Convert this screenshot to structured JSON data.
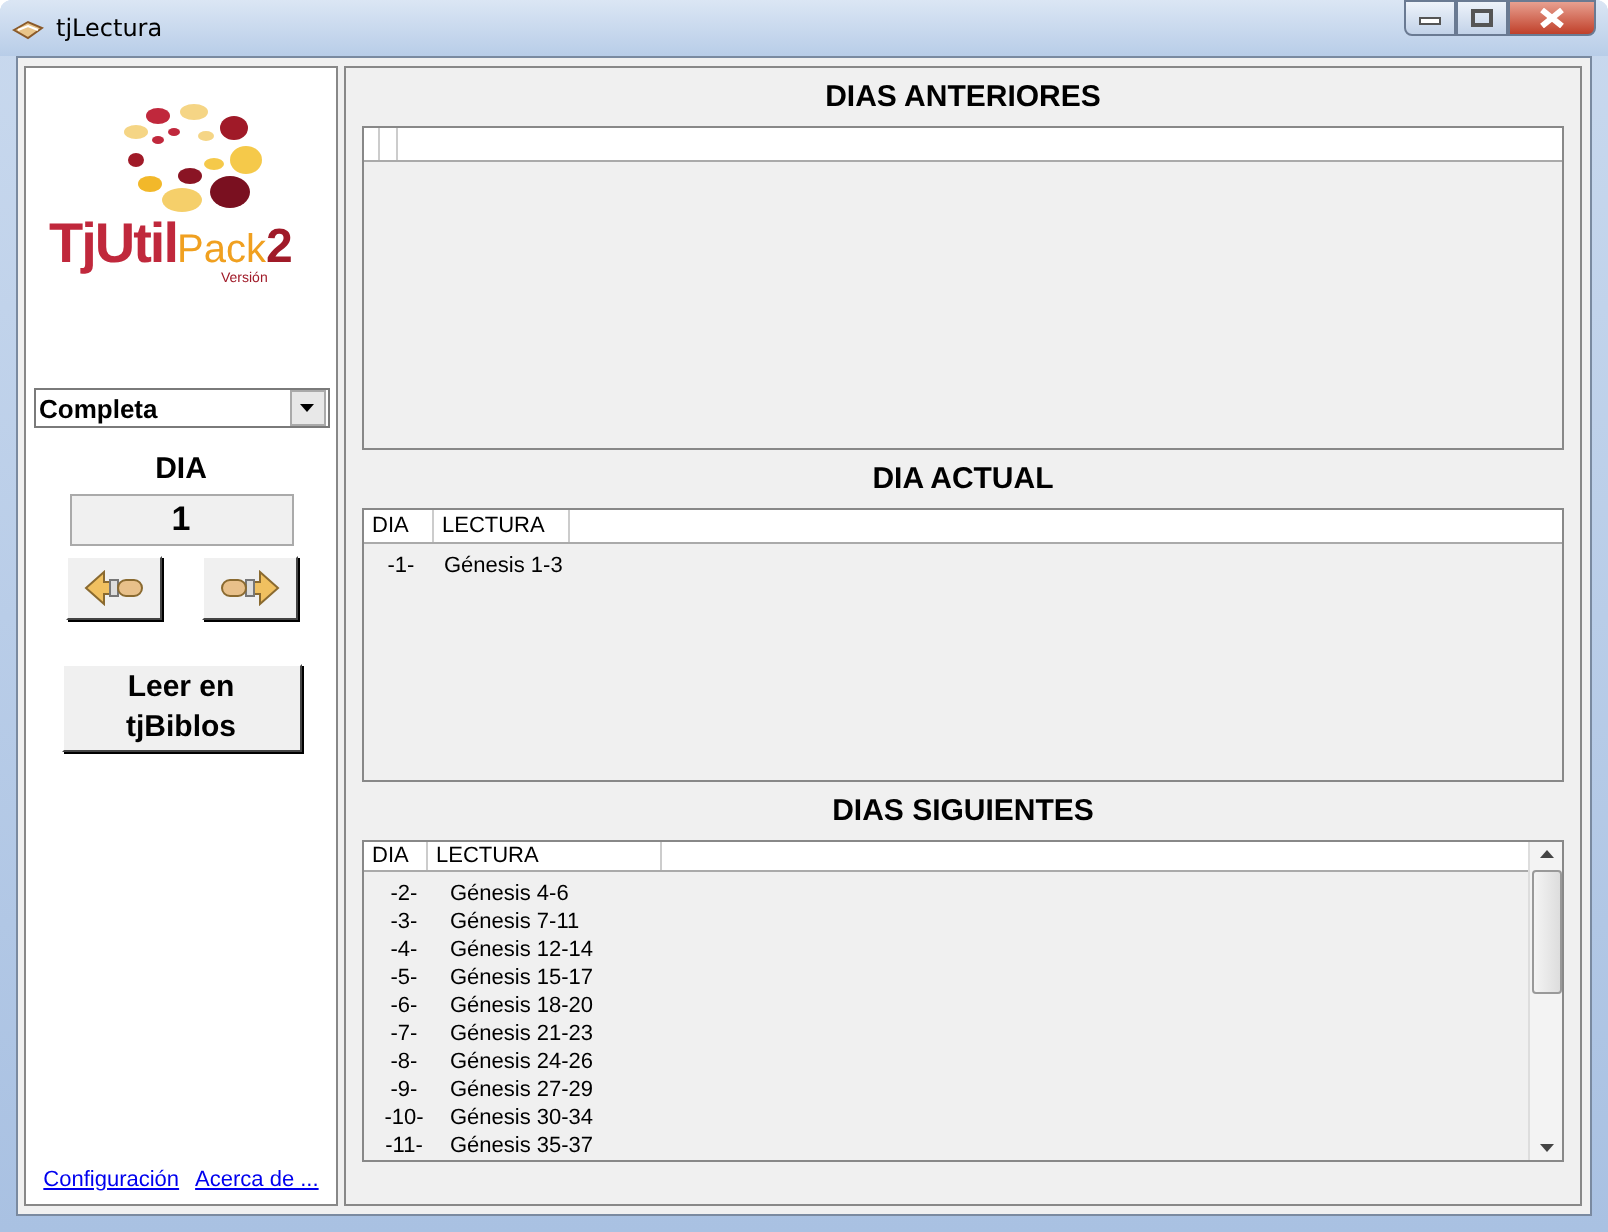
{
  "window": {
    "title": "tjLectura"
  },
  "logo": {
    "name": "TjUtil",
    "suffix": "Pack",
    "version_number": "2",
    "version_label": "Versión"
  },
  "plan_dropdown": {
    "value": "Completa"
  },
  "day": {
    "label": "DIA",
    "value": "1"
  },
  "read_button": {
    "label": "Leer en tjBiblos"
  },
  "links": [
    "Configuración",
    "Acerca de ..."
  ],
  "sections": [
    {
      "title": "DIAS ANTERIORES",
      "scrollbar": false
    },
    {
      "title": "DIA ACTUAL",
      "columns": [
        "DIA",
        "LECTURA"
      ],
      "rows": [
        {
          "dia": "-1-",
          "lectura": "Génesis 1-3"
        }
      ],
      "scrollbar": false
    },
    {
      "title": "DIAS SIGUIENTES",
      "columns": [
        "DIA",
        "LECTURA"
      ],
      "rows": [
        {
          "dia": "-2-",
          "lectura": "Génesis 4-6"
        },
        {
          "dia": "-3-",
          "lectura": "Génesis 7-11"
        },
        {
          "dia": "-4-",
          "lectura": "Génesis 12-14"
        },
        {
          "dia": "-5-",
          "lectura": "Génesis 15-17"
        },
        {
          "dia": "-6-",
          "lectura": "Génesis 18-20"
        },
        {
          "dia": "-7-",
          "lectura": "Génesis 21-23"
        },
        {
          "dia": "-8-",
          "lectura": "Génesis 24-26"
        },
        {
          "dia": "-9-",
          "lectura": "Génesis 27-29"
        },
        {
          "dia": "-10-",
          "lectura": "Génesis 30-34"
        },
        {
          "dia": "-11-",
          "lectura": "Génesis 35-37"
        }
      ],
      "scrollbar": true
    }
  ]
}
